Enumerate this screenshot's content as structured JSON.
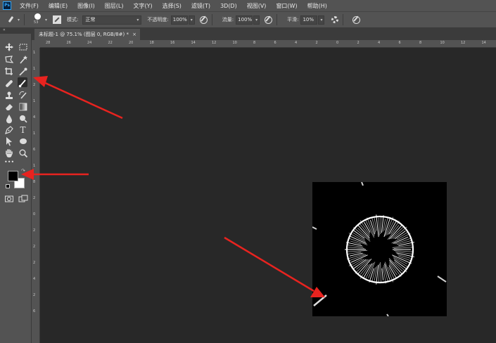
{
  "app": {
    "logo": "Ps"
  },
  "menu": [
    "文件(F)",
    "编辑(E)",
    "图像(I)",
    "图层(L)",
    "文字(Y)",
    "选择(S)",
    "滤镜(T)",
    "3D(D)",
    "视图(V)",
    "窗口(W)",
    "帮助(H)"
  ],
  "options": {
    "brush_size": "53",
    "mode_label": "模式:",
    "mode_value": "正常",
    "opacity_label": "不透明度:",
    "opacity_value": "100%",
    "flow_label": "流量:",
    "flow_value": "100%",
    "smoothing_label": "平滑:",
    "smoothing_value": "10%"
  },
  "document_tab": {
    "title": "未标题-1 @ 75.1% (图层 0, RGB/8#) *",
    "close": "×"
  },
  "toolbox": {
    "icons": [
      "move-icon",
      "marquee-icon",
      "lasso-icon",
      "magic-wand-icon",
      "crop-icon",
      "eyedropper-icon",
      "healing-brush-icon",
      "brush-icon",
      "clone-stamp-icon",
      "history-brush-icon",
      "eraser-icon",
      "gradient-icon",
      "blur-icon",
      "dodge-icon",
      "pen-icon",
      "type-icon",
      "path-selection-icon",
      "shape-icon",
      "hand-icon",
      "zoom-icon",
      "more-icon"
    ],
    "active_tool": "brush-icon",
    "foreground_color": "#000000",
    "background_color": "#ffffff",
    "type_glyph": "T",
    "more_glyph": "•••"
  },
  "rulers": {
    "top_labels": [
      "28",
      "26",
      "24",
      "22",
      "20",
      "18",
      "16",
      "14",
      "12",
      "10",
      "8",
      "6",
      "4",
      "2",
      "0",
      "2",
      "4",
      "6",
      "8",
      "10",
      "12",
      "14"
    ],
    "left_labels": [
      "1",
      "1",
      "2",
      "1",
      "4",
      "1",
      "6",
      "1",
      "8",
      "2",
      "0",
      "2",
      "2",
      "2",
      "4",
      "2",
      "6"
    ]
  },
  "colors": {
    "annotation_arrow": "#e8231f",
    "accent": "#31a8ff"
  }
}
